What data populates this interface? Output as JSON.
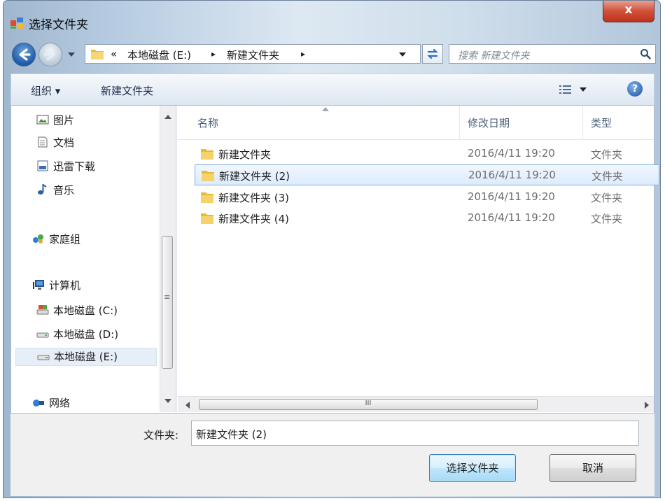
{
  "window": {
    "title": "选择文件夹",
    "close_label": "x"
  },
  "address": {
    "overflow": "«",
    "crumbs": [
      "本地磁盘 (E:)",
      "新建文件夹"
    ],
    "sep": "▸"
  },
  "search": {
    "placeholder": "搜索 新建文件夹"
  },
  "toolbar": {
    "organize_label": "组织 ▾",
    "new_folder_label": "新建文件夹",
    "help": "?"
  },
  "nav": {
    "items": [
      {
        "label": "图片",
        "icon": "pictures-icon"
      },
      {
        "label": "文档",
        "icon": "documents-icon"
      },
      {
        "label": "迅雷下载",
        "icon": "download-folder-icon"
      },
      {
        "label": "音乐",
        "icon": "music-icon"
      },
      {
        "label": "家庭组",
        "icon": "homegroup-icon"
      },
      {
        "label": "计算机",
        "icon": "computer-icon"
      },
      {
        "label": "本地磁盘 (C:)",
        "icon": "system-drive-icon"
      },
      {
        "label": "本地磁盘 (D:)",
        "icon": "drive-icon"
      },
      {
        "label": "本地磁盘 (E:)",
        "icon": "drive-icon",
        "selected": true
      },
      {
        "label": "网络",
        "icon": "network-icon"
      }
    ]
  },
  "columns": {
    "name": "名称",
    "modified": "修改日期",
    "type": "类型"
  },
  "files": [
    {
      "name": "新建文件夹",
      "modified": "2016/4/11 19:20",
      "type": "文件夹"
    },
    {
      "name": "新建文件夹 (2)",
      "modified": "2016/4/11 19:20",
      "type": "文件夹",
      "selected": true
    },
    {
      "name": "新建文件夹 (3)",
      "modified": "2016/4/11 19:20",
      "type": "文件夹"
    },
    {
      "name": "新建文件夹 (4)",
      "modified": "2016/4/11 19:20",
      "type": "文件夹"
    }
  ],
  "hscroll_grip": "III",
  "vscroll_grip": "≡",
  "footer": {
    "folder_label": "文件夹:",
    "folder_value": "新建文件夹 (2)",
    "select_label": "选择文件夹",
    "cancel_label": "取消"
  },
  "colors": {
    "selection": "#dcebfc",
    "selection_border": "#84acdd",
    "accent": "#1f5aa8"
  }
}
